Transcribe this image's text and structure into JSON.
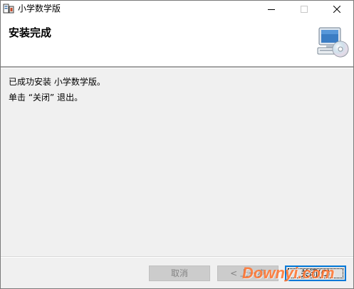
{
  "window": {
    "title": "小学数学版",
    "controls": {
      "minimize_icon": "minimize-icon",
      "maximize_icon": "maximize-icon",
      "close_icon": "close-icon"
    }
  },
  "header": {
    "title": "安装完成",
    "icon": "installer-cd-computer-icon"
  },
  "body": {
    "message1": "已成功安装 小学数学版。",
    "message2": "单击 “关闭” 退出。"
  },
  "footer": {
    "cancel_label": "取消",
    "back_label": "< 上一步",
    "close_label": "关闭(C)"
  },
  "watermark": {
    "text": "Downyi.com"
  },
  "colors": {
    "accent": "#0078d7",
    "watermark": "#ff6e28",
    "dialog_bg": "#f0f0f0"
  }
}
